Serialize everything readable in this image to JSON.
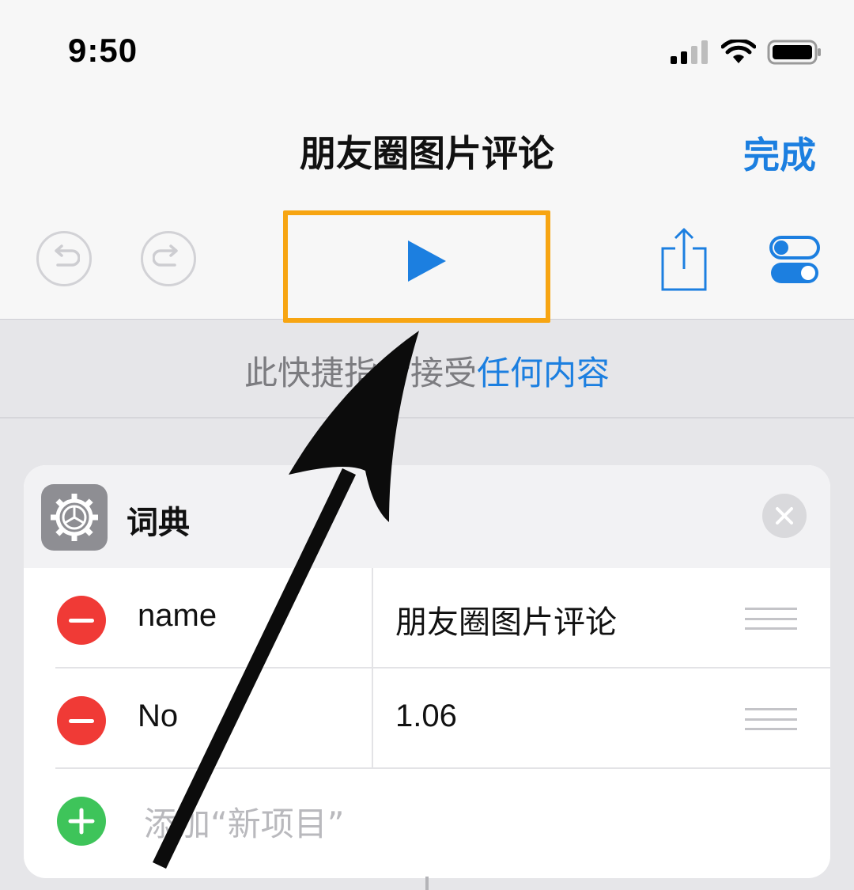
{
  "status_bar": {
    "time": "9:50",
    "icons": [
      "cellular-signal-icon",
      "wifi-icon",
      "battery-icon"
    ]
  },
  "nav": {
    "title": "朋友圈图片评论",
    "done_label": "完成"
  },
  "toolbar": {
    "undo_icon": "undo-icon",
    "redo_icon": "redo-icon",
    "run_icon": "play-icon",
    "share_icon": "share-icon",
    "settings_icon": "toggle-settings-icon",
    "highlight_color": "#f7a512"
  },
  "input_info": {
    "prefix": "此快捷指令接受",
    "link": "任何内容"
  },
  "dictionary_action": {
    "title": "词典",
    "icon": "gear-icon",
    "rows": [
      {
        "key": "name",
        "value": "朋友圈图片评论"
      },
      {
        "key": "No",
        "value": "1.06"
      }
    ],
    "add_label": "添加“新项目”"
  },
  "colors": {
    "accent": "#1c7fe0",
    "remove": "#f03a36",
    "add": "#3ec45a"
  }
}
